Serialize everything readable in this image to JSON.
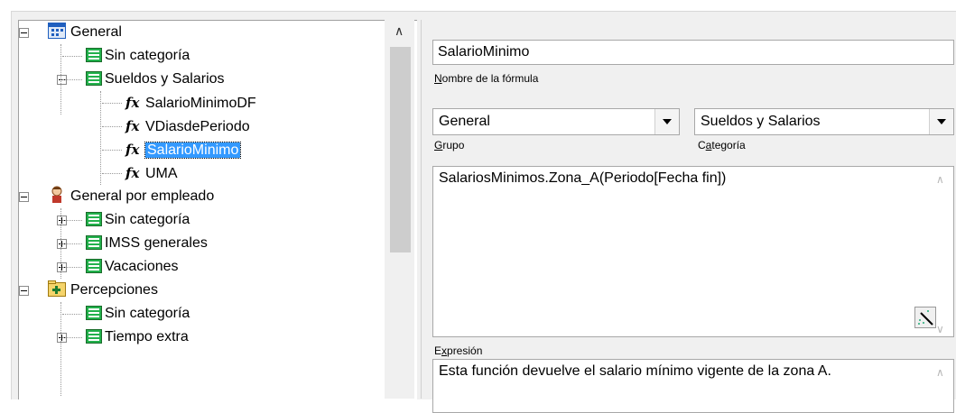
{
  "tree": {
    "items": [
      {
        "label": "General",
        "level": 0,
        "expander": "minus",
        "icon": "calendar-icon"
      },
      {
        "label": "Sin categoría",
        "level": 1,
        "expander": "none",
        "icon": "list-icon"
      },
      {
        "label": "Sueldos y Salarios",
        "level": 1,
        "expander": "minus",
        "icon": "list-icon"
      },
      {
        "label": "SalarioMinimoDF",
        "level": 2,
        "expander": "none",
        "icon": "fx-icon"
      },
      {
        "label": "VDiasdePeriodo",
        "level": 2,
        "expander": "none",
        "icon": "fx-icon"
      },
      {
        "label": "SalarioMinimo",
        "level": 2,
        "expander": "none",
        "icon": "fx-icon",
        "selected": true
      },
      {
        "label": "UMA",
        "level": 2,
        "expander": "none",
        "icon": "fx-icon"
      },
      {
        "label": "General por empleado",
        "level": 0,
        "expander": "minus",
        "icon": "person-icon"
      },
      {
        "label": "Sin categoría",
        "level": 1,
        "expander": "plus",
        "icon": "list-icon"
      },
      {
        "label": "IMSS generales",
        "level": 1,
        "expander": "plus",
        "icon": "list-icon"
      },
      {
        "label": "Vacaciones",
        "level": 1,
        "expander": "plus",
        "icon": "list-icon"
      },
      {
        "label": "Percepciones",
        "level": 0,
        "expander": "minus",
        "icon": "plus-folder-icon"
      },
      {
        "label": "Sin categoría",
        "level": 1,
        "expander": "none",
        "icon": "list-icon"
      },
      {
        "label": "Tiempo extra",
        "level": 1,
        "expander": "plus",
        "icon": "list-icon"
      }
    ],
    "fx_glyph": "fx"
  },
  "form": {
    "name_value": "SalarioMinimo",
    "name_label": "Nombre de la fórmula",
    "group_value": "General",
    "group_label": "Grupo",
    "category_value": "Sueldos y Salarios",
    "category_label": "Categoría",
    "expression_value": "SalariosMinimos.Zona_A(Periodo[Fecha fin])",
    "expression_label": "Expresión",
    "description_value": "Esta función devuelve el salario mínimo vigente de la zona A."
  },
  "colors": {
    "selection": "#3399ff",
    "list_icon": "#22b14c",
    "calendar_icon": "#1f5fbf"
  }
}
